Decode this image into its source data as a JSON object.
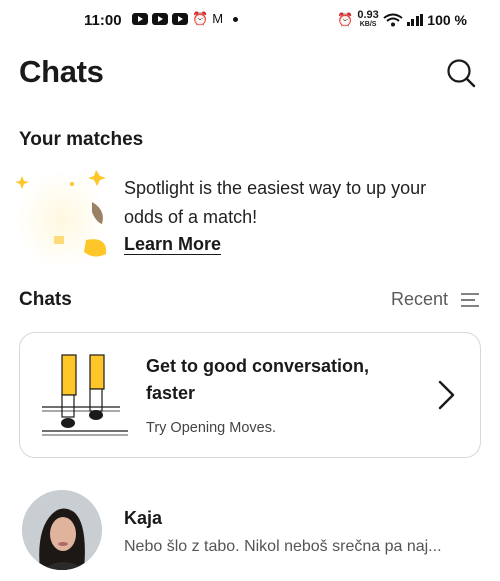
{
  "status_bar": {
    "time": "11:00",
    "net_speed_value": "0.93",
    "net_speed_unit": "KB/S",
    "battery": "100 %"
  },
  "header": {
    "title": "Chats",
    "search_icon": "search-icon"
  },
  "matches": {
    "heading": "Your matches",
    "spotlight_text": "Spotlight is the easiest way to up your odds of a match!",
    "learn_more": "Learn More"
  },
  "chats_section": {
    "heading": "Chats",
    "sort_label": "Recent",
    "sort_icon": "sort-lines-icon"
  },
  "opening_moves": {
    "title": "Get to good conversation, faster",
    "subtitle": "Try Opening Moves."
  },
  "chats": [
    {
      "name": "Kaja",
      "preview": "Nebo šlo z tabo. Nikol neboš srečna pa naj..."
    }
  ],
  "colors": {
    "accent_yellow": "#ffc629",
    "text": "#1a1a1a",
    "muted": "#555555",
    "border": "#d8d8d8"
  }
}
